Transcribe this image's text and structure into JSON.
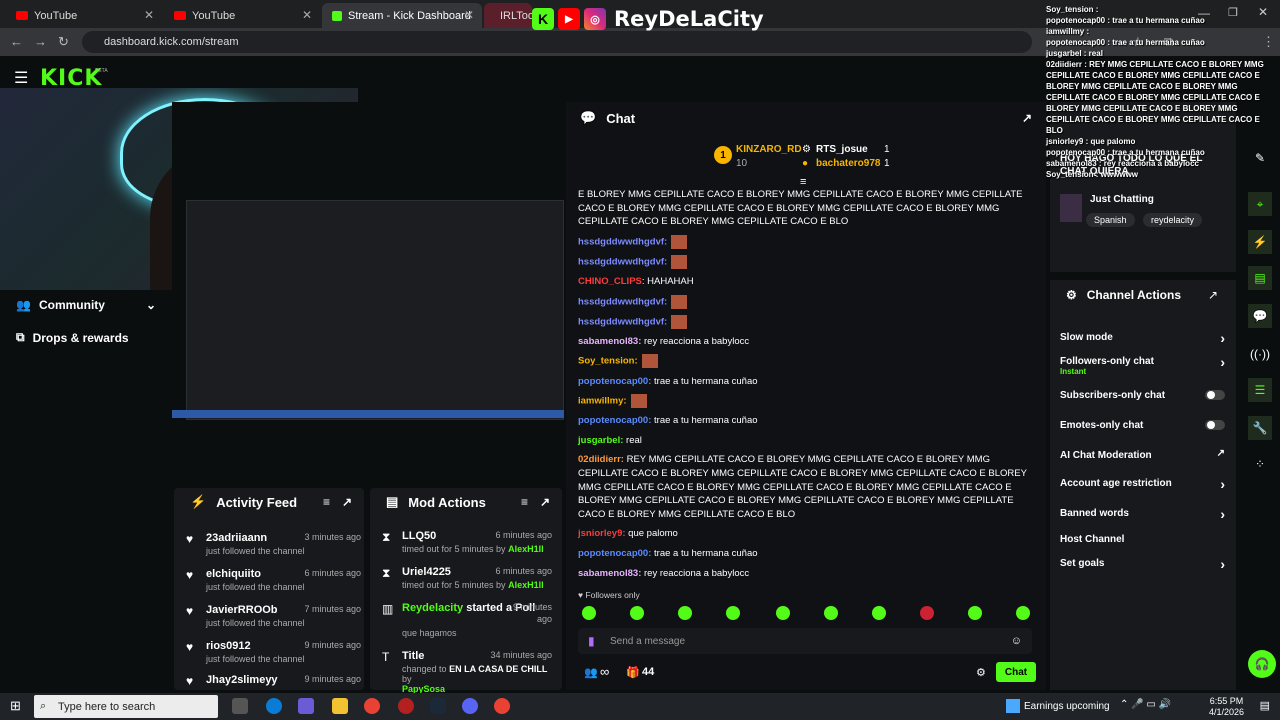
{
  "browser": {
    "tabs": [
      {
        "label": "YouTube"
      },
      {
        "label": "YouTube"
      },
      {
        "label": "Stream - Kick Dashboard"
      },
      {
        "label": "IRLTools"
      }
    ],
    "url": "dashboard.kick.com/stream"
  },
  "brand": {
    "logo": "KICK",
    "beta": "BETA"
  },
  "overlay": {
    "stream_name": "ReyDeLaCity"
  },
  "sidebar": {
    "items": [
      {
        "label": "Community"
      },
      {
        "label": "Drops & rewards"
      }
    ]
  },
  "chat": {
    "title": "Chat",
    "leaderboard": [
      {
        "name": "KINZARO_RD",
        "rank": "1",
        "count": "10"
      },
      {
        "name": "RTS_josue",
        "count": "1"
      },
      {
        "name": "bachatero978",
        "count": "1"
      }
    ],
    "messages": [
      {
        "user": "",
        "text": "E BLOREY MMG CEPILLATE CACO E BLOREY MMG CEPILLATE CACO E BLOREY MMG CEPILLATE CACO E BLOREY MMG CEPILLATE CACO E BLOREY MMG CEPILLATE CACO E BLOREY MMG CEPILLATE CACO E BLOREY MMG CEPILLATE CACO E BLO",
        "color": "#ffffff"
      },
      {
        "user": "hssdgddwwdhgdvf:",
        "text": "",
        "color": "#7c8cff"
      },
      {
        "user": "hssdgddwwdhgdvf:",
        "text": "",
        "color": "#7c8cff"
      },
      {
        "user": "CHINO_CLIPS",
        "text": ": HAHAHAH",
        "color": "#ff3b3b"
      },
      {
        "user": "hssdgddwwdhgdvf:",
        "text": "",
        "color": "#7c8cff"
      },
      {
        "user": "hssdgddwwdhgdvf:",
        "text": "",
        "color": "#7c8cff"
      },
      {
        "user": "sabamenol83:",
        "text": " rey reacciona a babylocc",
        "color": "#e9b3ff"
      },
      {
        "user": "Soy_tension:",
        "text": "",
        "color": "#f7b500"
      },
      {
        "user": "popotenocap00:",
        "text": " trae a tu hermana cuñao",
        "color": "#5b8bff"
      },
      {
        "user": "iamwillmy:",
        "text": "",
        "color": "#f7b500"
      },
      {
        "user": "popotenocap00:",
        "text": " trae a tu hermana cuñao",
        "color": "#5b8bff"
      },
      {
        "user": "jusgarbel:",
        "text": " real",
        "color": "#53fc18"
      },
      {
        "user": "02diidierr:",
        "text": " REY MMG CEPILLATE CACO E BLOREY MMG CEPILLATE CACO E BLOREY MMG CEPILLATE CACO E BLOREY MMG CEPILLATE CACO E BLOREY MMG CEPILLATE CACO E BLOREY MMG CEPILLATE CACO E BLOREY MMG CEPILLATE CACO E BLOREY MMG CEPILLATE CACO E BLOREY MMG CEPILLATE CACO E BLOREY MMG CEPILLATE CACO E BLOREY MMG CEPILLATE CACO E BLOREY MMG CEPILLATE CACO E BLO",
        "color": "#ff9a3c"
      },
      {
        "user": "jsniorley9:",
        "text": " que palomo",
        "color": "#ff3b3b"
      },
      {
        "user": "popotenocap00:",
        "text": " trae a tu hermana cuñao",
        "color": "#5b8bff"
      },
      {
        "user": "sabamenol83:",
        "text": " rey reacciona a babylocc",
        "color": "#e9b3ff"
      }
    ],
    "followers_only": "Followers only",
    "input_placeholder": "Send a message",
    "viewer_count": "44",
    "infinite": "∞",
    "send_label": "Chat"
  },
  "activity_feed": {
    "title": "Activity Feed",
    "items": [
      {
        "name": "23adriiaann",
        "sub": "just followed the channel",
        "time": "3 minutes ago"
      },
      {
        "name": "elchiquiito",
        "sub": "just followed the channel",
        "time": "6 minutes ago"
      },
      {
        "name": "JavierRROOb",
        "sub": "just followed the channel",
        "time": "7 minutes ago"
      },
      {
        "name": "rios0912",
        "sub": "just followed the channel",
        "time": "9 minutes ago"
      },
      {
        "name": "Jhay2slimeyy",
        "sub": "",
        "time": "9 minutes ago"
      }
    ]
  },
  "mod_actions": {
    "title": "Mod Actions",
    "items": [
      {
        "name": "LLQ50",
        "sub": "timed out for 5 minutes by",
        "by": "AlexH1ll",
        "time": "6 minutes ago"
      },
      {
        "name": "Uriel4225",
        "sub": "timed out for 5 minutes by",
        "by": "AlexH1ll",
        "time": "6 minutes ago"
      },
      {
        "name": "Reydelacity",
        "action": "started a Poll",
        "sub": "que hagamos",
        "time1": "9 minutes",
        "time2": "ago"
      },
      {
        "name": "Title",
        "sub1": "changed to",
        "sub2": "EN LA CASA DE CHILL",
        "sub3": "by",
        "by": "PapySosa",
        "time": "34 minutes ago"
      }
    ]
  },
  "stream_info": {
    "title": "Stream Info",
    "stream_title": "HOY HAGO TODO LO QUE EL CHAT QUIERA",
    "category": "Just Chatting",
    "tags": [
      "Spanish",
      "reydelacity"
    ]
  },
  "channel_actions": {
    "title": "Channel Actions",
    "items": [
      {
        "label": "Slow mode",
        "type": "arrow"
      },
      {
        "label": "Followers-only chat",
        "sub": "Instant",
        "type": "arrow"
      },
      {
        "label": "Subscribers-only chat",
        "type": "toggle"
      },
      {
        "label": "Emotes-only chat",
        "type": "toggle"
      },
      {
        "label": "AI Chat Moderation",
        "type": "external"
      },
      {
        "label": "Account age restriction",
        "type": "arrow"
      },
      {
        "label": "Banned words",
        "type": "arrow"
      },
      {
        "label": "Host Channel",
        "type": "none"
      },
      {
        "label": "Set goals",
        "type": "arrow"
      }
    ]
  },
  "overlay_chat": {
    "lines": [
      "Soy_tension :",
      "popotenocap00 : trae a tu hermana cuñao",
      "iamwillmy :",
      "popotenocap00 : trae a tu hermana cuñao",
      "jusgarbel : real",
      "02diidierr : REY MMG CEPILLATE CACO E BLOREY MMG CEPILLATE CACO E BLOREY MMG CEPILLATE CACO E BLOREY MMG CEPILLATE CACO E BLOREY MMG CEPILLATE CACO E BLOREY MMG CEPILLATE CACO E BLOREY MMG CEPILLATE CACO E BLOREY MMG CEPILLATE CACO E BLOREY MMG CEPILLATE CACO E BLO",
      "jsniorley9 : que palomo",
      "popotenocap00 : trae a tu hermana cuñao",
      "sabamenol83 : rey reacciona a babylocc",
      "Soy_tension : wwwwww"
    ]
  },
  "taskbar": {
    "search_placeholder": "Type here to search",
    "weather": "Earnings upcoming",
    "time": "6:55 PM",
    "date": "4/1/2026"
  },
  "colors": {
    "kick_green": "#53fc18",
    "panel_bg": "#18191c",
    "page_bg": "#0b0e0f"
  }
}
